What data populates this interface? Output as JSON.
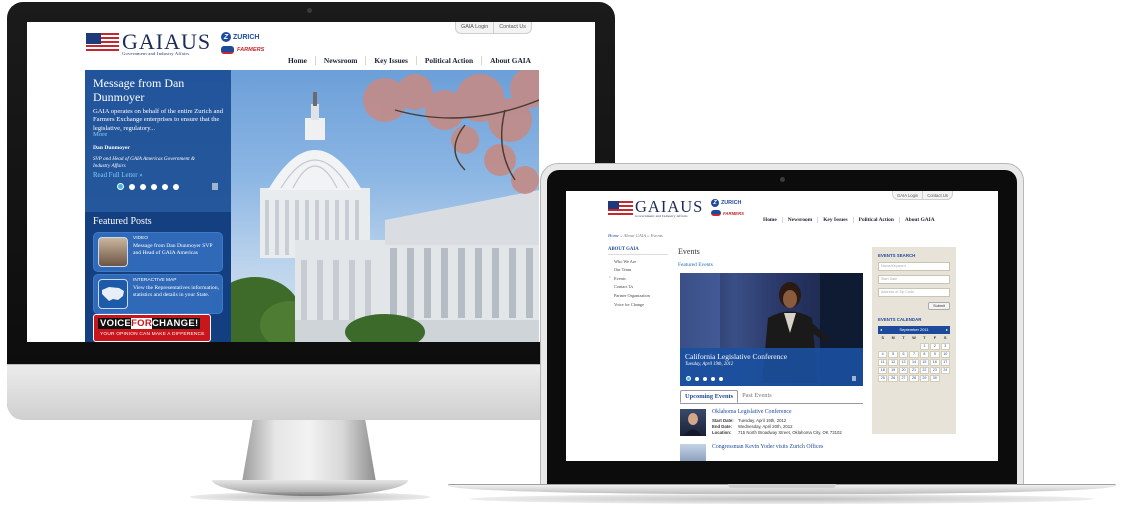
{
  "site": {
    "logo_text": "GAIAUS",
    "logo_subtitle": "Government and Industry Affairs",
    "partner_zurich": "ZURICH",
    "partner_farmers": "FARMERS",
    "top_links": [
      "GAIA Login",
      "Contact Us"
    ],
    "nav": [
      "Home",
      "Newsroom",
      "Key Issues",
      "Political Action",
      "About GAIA"
    ],
    "brand_blue": "#1e4a9c",
    "brand_red": "#c4272e"
  },
  "desktop": {
    "hero": {
      "title": "Message from Dan Dunmoyer",
      "text": "GAIA operates on behalf of the entire Zurich and Farmers Exchange enterprises to ensure that the legislative, regulatory...",
      "more": "More",
      "author": "Dan Dunmoyer",
      "role": "SVP and Head of GAIA Americas Government & Industry Affairs",
      "read_full": "Read Full Letter",
      "slide_count": 6,
      "active_slide": 1
    },
    "featured": {
      "title": "Featured Posts",
      "items": [
        {
          "type": "VIDEO",
          "text": "Message from Dan Dunmoyer SVP and Head of GAIA Americas"
        },
        {
          "type": "INTERACTIVE MAP",
          "text": "View the Representatives information, statistics and details in your State."
        }
      ],
      "banner_line1_a": "VOICE",
      "banner_line1_b": "FOR",
      "banner_line1_c": "CHANGE!",
      "banner_line2": "YOUR OPINION CAN MAKE A DIFFERENCE"
    }
  },
  "laptop": {
    "breadcrumb": {
      "home": "Home",
      "rest": " » About GAIA » Events"
    },
    "left_nav": {
      "heading": "ABOUT GAIA",
      "items": [
        "Who We Are",
        "Our Team",
        "Events",
        "Contact Us",
        "Partner Organization",
        "Voice for Change"
      ]
    },
    "main": {
      "title": "Events",
      "featured_label": "Featured Events",
      "slide_title": "California Legislative Conference",
      "slide_date": "Tuesday, April 19th, 2012",
      "tabs": [
        "Upcoming Events",
        "Past Events"
      ],
      "events": [
        {
          "title": "Oklahoma Legislative Conference",
          "start_label": "Start Date:",
          "start": "Tuesday, April 19th, 2012",
          "end_label": "End Date:",
          "end": "Wednesday, April 20th, 2012",
          "loc_label": "Location:",
          "loc": "715 North Broadway Street, Oklahoma City, OK 73102"
        },
        {
          "title": "Congressman Kevin Yoder visits Zurich Offices"
        }
      ]
    },
    "sidebar": {
      "search_heading": "EVENTS SEARCH",
      "field1": "Name/Keyword",
      "field2": "Start Date",
      "field3": "Address or Zip Code",
      "submit": "Submit",
      "calendar_heading": "EVENTS CALENDAR",
      "calendar_month": "September 2011",
      "weekdays": [
        "S",
        "M",
        "T",
        "W",
        "T",
        "F",
        "S"
      ],
      "weeks": [
        [
          "",
          "",
          "",
          "",
          "1",
          "2",
          "3"
        ],
        [
          "4",
          "5",
          "6",
          "7",
          "8",
          "9",
          "10"
        ],
        [
          "11",
          "12",
          "13",
          "14",
          "15",
          "16",
          "17"
        ],
        [
          "18",
          "19",
          "20",
          "21",
          "22",
          "23",
          "24"
        ],
        [
          "25",
          "26",
          "27",
          "28",
          "29",
          "30",
          ""
        ]
      ]
    }
  }
}
